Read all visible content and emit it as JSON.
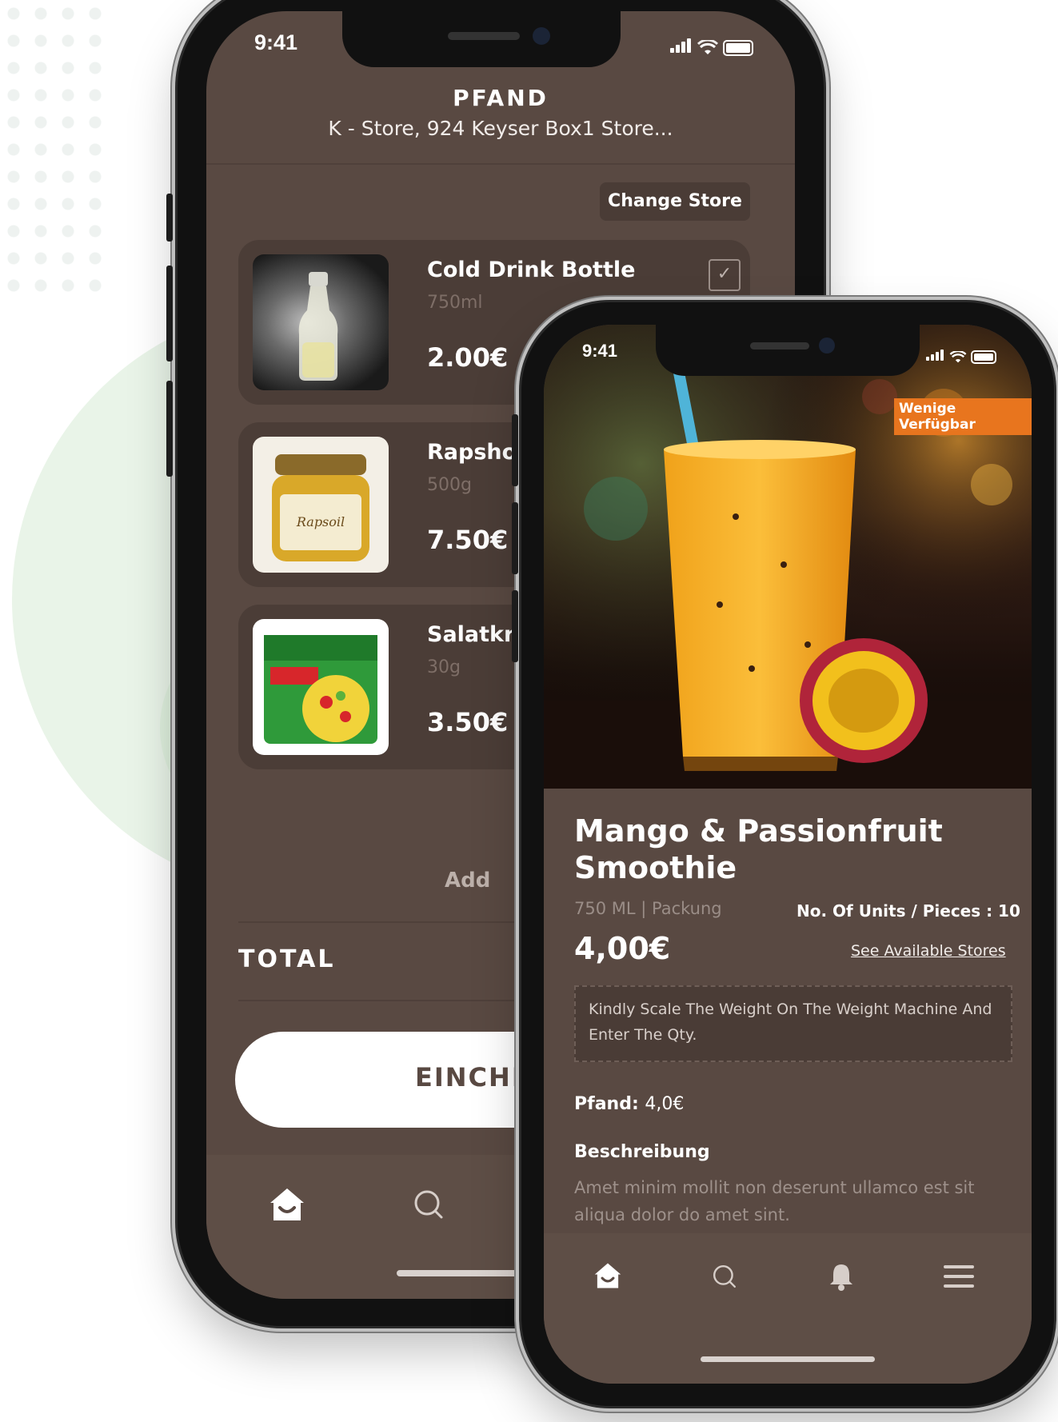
{
  "status": {
    "time": "9:41"
  },
  "back_phone": {
    "header": {
      "title": "PFAND",
      "store": "K - Store,  924 Keyser Box1 Store..."
    },
    "change_store_label": "Change Store",
    "items": [
      {
        "name": "Cold Drink Bottle",
        "size": "750ml",
        "price": "2.00€",
        "checked": true
      },
      {
        "name": "Rapsho",
        "size": "500g",
        "price": "7.50€"
      },
      {
        "name": "Salatkrä",
        "size": "30g",
        "price": "3.50€"
      }
    ],
    "add_label": "Add",
    "total_label": "TOTAL",
    "checkout_label": "EINCHE"
  },
  "front_phone": {
    "badge": "Wenige Verfügbar",
    "product": {
      "title_line1": "Mango & Passionfruit",
      "title_line2": "Smoothie",
      "volume": "750 ML  | Packung",
      "units": "No. Of Units / Pieces : 10",
      "price": "4,00€",
      "stores_link": "See Available Stores",
      "scale_note": "Kindly Scale The Weight On The Weight Machine And Enter The Qty.",
      "pfand_label": "Pfand:",
      "pfand_value": "4,0€",
      "description_heading": "Beschreibung",
      "description": "Amet minim mollit non deserunt ullamco est sit aliqua dolor do amet sint."
    }
  },
  "tabs": {
    "home": "home-icon",
    "search": "search-icon",
    "notifications": "bell-icon",
    "menu": "menu-icon"
  },
  "colors": {
    "background": "#594942",
    "card": "#4b3d37",
    "accent_badge": "#e8751e"
  }
}
